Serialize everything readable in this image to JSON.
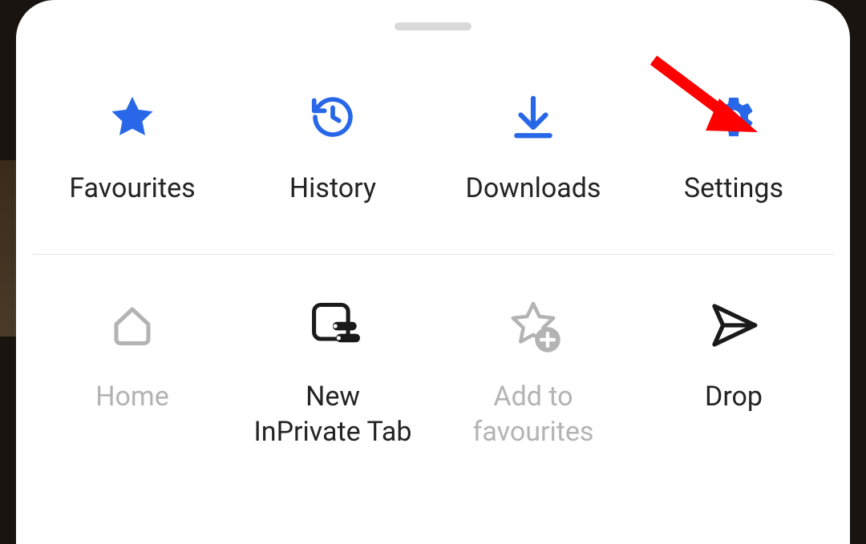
{
  "colors": {
    "accent": "#2767e8",
    "disabled": "#b3b3b3",
    "text": "#232323",
    "black": "#1a1a1a"
  },
  "top_row": {
    "items": [
      {
        "label": "Favourites",
        "icon": "star-icon"
      },
      {
        "label": "History",
        "icon": "history-icon"
      },
      {
        "label": "Downloads",
        "icon": "download-icon"
      },
      {
        "label": "Settings",
        "icon": "gear-icon"
      }
    ]
  },
  "bottom_row": {
    "items": [
      {
        "label": "Home",
        "icon": "home-icon",
        "state": "disabled"
      },
      {
        "label": "New\nInPrivate Tab",
        "icon": "inprivate-icon",
        "state": "enabled"
      },
      {
        "label": "Add to\nfavourites",
        "icon": "add-favourite-icon",
        "state": "disabled"
      },
      {
        "label": "Drop",
        "icon": "send-icon",
        "state": "enabled"
      }
    ]
  },
  "annotation": {
    "arrow_points_to": "gear-icon"
  }
}
